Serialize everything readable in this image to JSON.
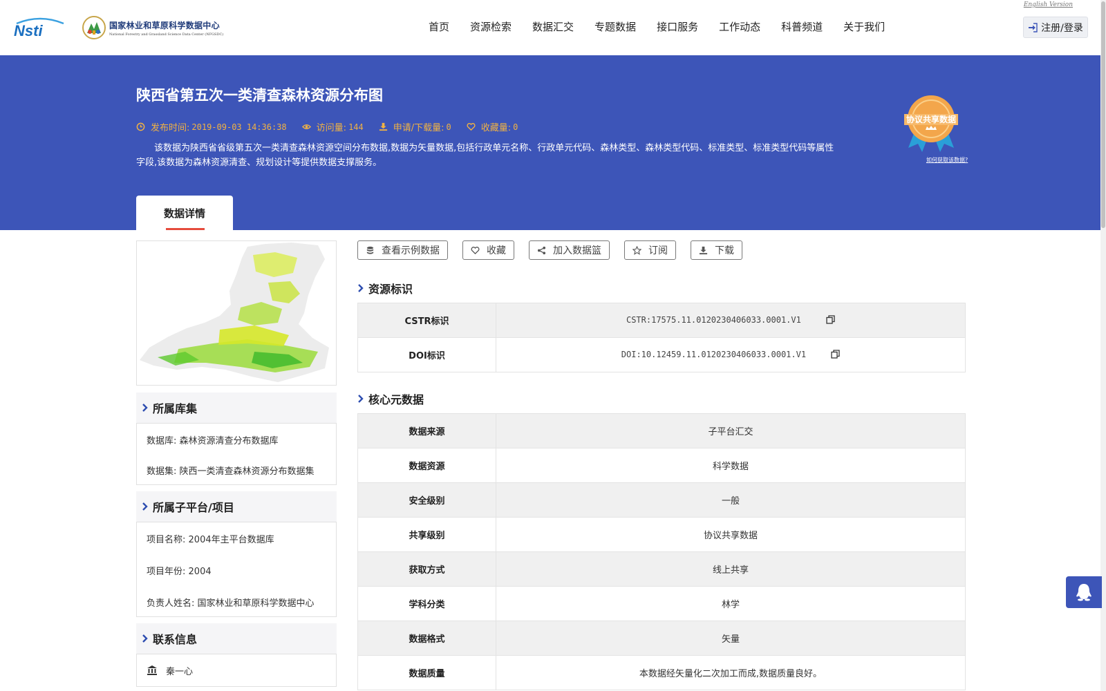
{
  "header": {
    "english_link": "English Version",
    "logo_nsti_text": "Nsti",
    "logo_cn": "国家林业和草原科学数据中心",
    "logo_en": "National Forestry and Grassland Science Data Center (NFGSDC)",
    "nav": [
      "首页",
      "资源检索",
      "数据汇交",
      "专题数据",
      "接口服务",
      "工作动态",
      "科普频道",
      "关于我们"
    ],
    "login_label": "注册/登录"
  },
  "banner": {
    "title": "陕西省第五次一类清查森林资源分布图",
    "publish_label": "发布时间:",
    "publish_value": "2019-09-03 14:36:38",
    "visits_label": "访问量:",
    "visits_value": "144",
    "downloads_label": "申请/下载量:",
    "downloads_value": "0",
    "favorites_label": "收藏量:",
    "favorites_value": "0",
    "description": "该数据为陕西省省级第五次一类清查森林资源空间分布数据,数据为矢量数据,包括行政单元名称、行政单元代码、森林类型、森林类型代码、标准类型、标准类型代码等属性字段,该数据为森林资源清查、规划设计等提供数据支撑服务。",
    "badge_text": "协议共享数据",
    "badge_link": "如何获取该数据?",
    "tab_label": "数据详情"
  },
  "left": {
    "collection": {
      "title": "所属库集",
      "database_label": "数据库:",
      "database_value": "森林资源清查分布数据库",
      "dataset_label": "数据集:",
      "dataset_value": "陕西一类清查森林资源分布数据集"
    },
    "platform": {
      "title": "所属子平台/项目",
      "project_label": "项目名称:",
      "project_value": "2004年主平台数据库",
      "year_label": "项目年份:",
      "year_value": "2004",
      "owner_label": "负责人姓名:",
      "owner_value": "国家林业和草原科学数据中心"
    },
    "contact": {
      "title": "联系信息",
      "name": "秦一心"
    }
  },
  "actions": [
    "查看示例数据",
    "收藏",
    "加入数据篮",
    "订阅",
    "下载"
  ],
  "resource_id": {
    "title": "资源标识",
    "rows": [
      {
        "key": "CSTR标识",
        "value": "CSTR:17575.11.0120230406033.0001.V1"
      },
      {
        "key": "DOI标识",
        "value": "DOI:10.12459.11.0120230406033.0001.V1"
      }
    ]
  },
  "core_meta": {
    "title": "核心元数据",
    "rows": [
      {
        "key": "数据来源",
        "value": "子平台汇交"
      },
      {
        "key": "数据资源",
        "value": "科学数据"
      },
      {
        "key": "安全级别",
        "value": "一般"
      },
      {
        "key": "共享级别",
        "value": "协议共享数据"
      },
      {
        "key": "获取方式",
        "value": "线上共享"
      },
      {
        "key": "学科分类",
        "value": "林学"
      },
      {
        "key": "数据格式",
        "value": "矢量"
      },
      {
        "key": "数据质量",
        "value": "本数据经矢量化二次加工而成,数据质量良好。"
      }
    ]
  },
  "colors": {
    "banner": "#3d55b8",
    "meta_accent": "#f1b243",
    "tab_underline": "#e54b3c",
    "nav_chevron": "#2d4db0"
  }
}
